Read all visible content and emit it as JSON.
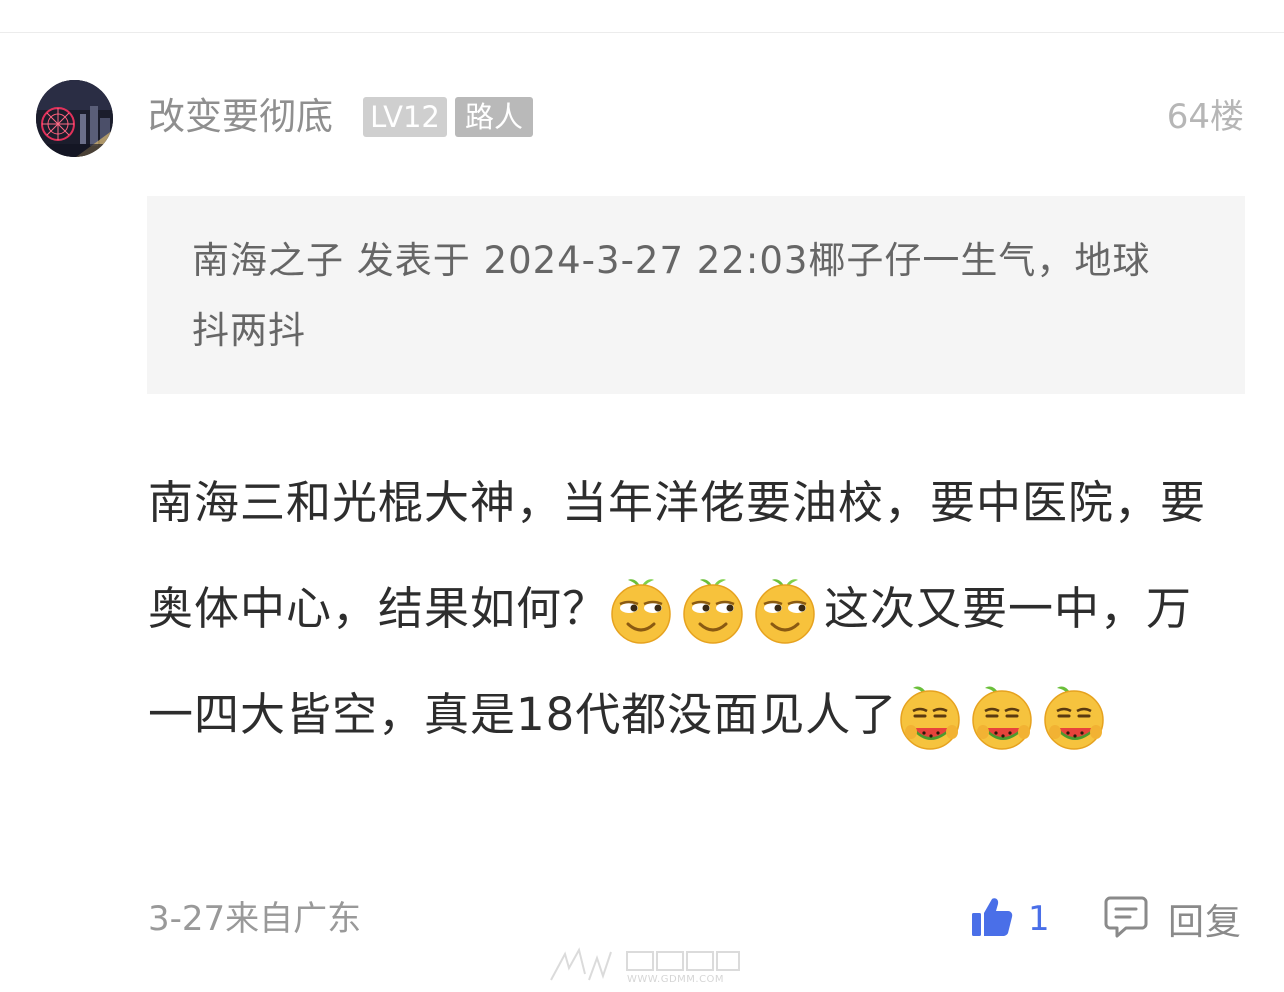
{
  "post": {
    "username": "改变要彻底",
    "level_badge": "LV12",
    "title_badge": "路人",
    "floor": "64楼",
    "quote": {
      "text": "南海之子 发表于 2024-3-27 22:03椰子仔一生气，地球抖两抖"
    },
    "content": {
      "segment_1": "南海三和光棍大神，当年洋佬要油校，要中医院，要奥体中心，结果如何？",
      "segment_2": "这次又要一中，万一四大皆空，真是18代都没面见人了"
    },
    "emojis": {
      "group_1": [
        "smirk-emoji",
        "smirk-emoji",
        "smirk-emoji"
      ],
      "group_2": [
        "eating-watermelon-emoji",
        "eating-watermelon-emoji",
        "eating-watermelon-emoji"
      ]
    },
    "meta": "3-27来自广东",
    "like_count": "1",
    "reply_label": "回复"
  },
  "watermark": {
    "url": "WWW.GDMM.COM"
  },
  "colors": {
    "like_blue": "#4a6fe8",
    "badge_level_bg": "#cfcfcf",
    "badge_title_bg": "#b9b9b9",
    "quote_bg": "#f5f5f5"
  }
}
